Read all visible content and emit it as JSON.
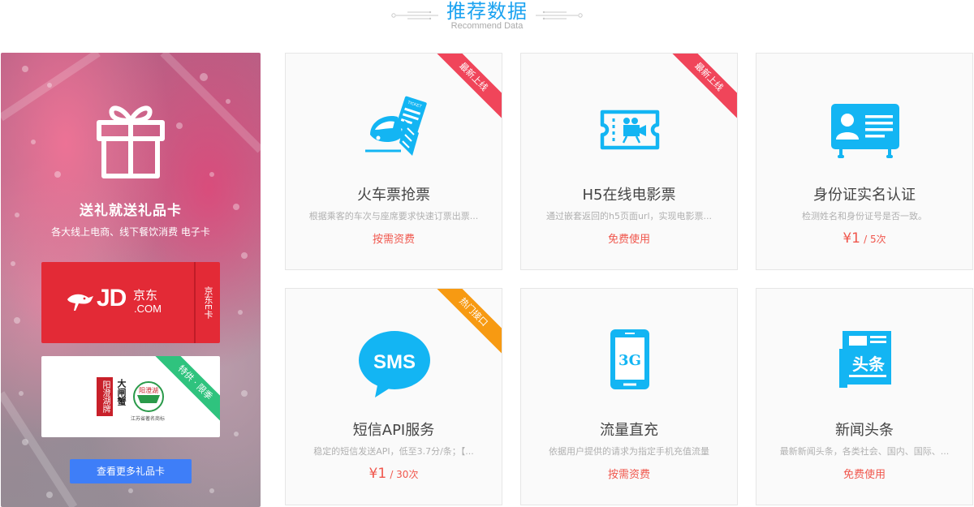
{
  "header": {
    "title": "推荐数据",
    "subtitle": "Recommend Data"
  },
  "promo": {
    "title": "送礼就送礼品卡",
    "desc": "各大线上电商、线下餐饮消费 电子卡",
    "jd_card": {
      "side_label": "京东E卡",
      "logo_text": "JD",
      "logo_cn": "京东",
      "logo_com": ".COM"
    },
    "crab_card": {
      "ribbon": "特供 · 限季",
      "brand_vertical": "阳澄湖牌",
      "brand_name": "大闸蟹",
      "caption": "江苏省著名商标",
      "seal_text": "阳澄湖"
    },
    "more_button": "查看更多礼品卡"
  },
  "cards": [
    {
      "title": "火车票抢票",
      "desc": "根据乘客的车次与座席要求快速订票出票...",
      "price_text": "按需资费",
      "ribbon": "最新上线",
      "ribbon_color": "#f0455a",
      "icon": "train-ticket-icon"
    },
    {
      "title": "H5在线电影票",
      "desc": "通过嵌套返回的h5页面url，实现电影票...",
      "price_text": "免费使用",
      "ribbon": "最新上线",
      "ribbon_color": "#f0455a",
      "icon": "movie-ticket-icon"
    },
    {
      "title": "身份证实名认证",
      "desc": "检测姓名和身份证号是否一致。",
      "price": "¥1",
      "unit": "/ 5次",
      "icon": "id-card-icon"
    },
    {
      "title": "短信API服务",
      "desc": "稳定的短信发送API，低至3.7分/条；【...",
      "price": "¥1",
      "unit": "/ 30次",
      "ribbon": "热门接口",
      "ribbon_color": "#f79a12",
      "icon": "sms-icon"
    },
    {
      "title": "流量直充",
      "desc": "依据用户提供的请求为指定手机充值流量",
      "price_text": "按需资费",
      "icon": "phone-3g-icon"
    },
    {
      "title": "新闻头条",
      "desc": "最新新闻头条，各类社会、国内、国际、...",
      "price_text": "免费使用",
      "icon": "news-icon"
    }
  ],
  "icon_labels": {
    "ticket": "TICKET",
    "sms": "SMS",
    "g3": "3G",
    "news": "头条"
  },
  "colors": {
    "accent": "#1aa2f0",
    "price": "#f0564c",
    "button": "#3e7ef8",
    "jd_red": "#e32a36",
    "icon_blue": "#13b5f3"
  }
}
